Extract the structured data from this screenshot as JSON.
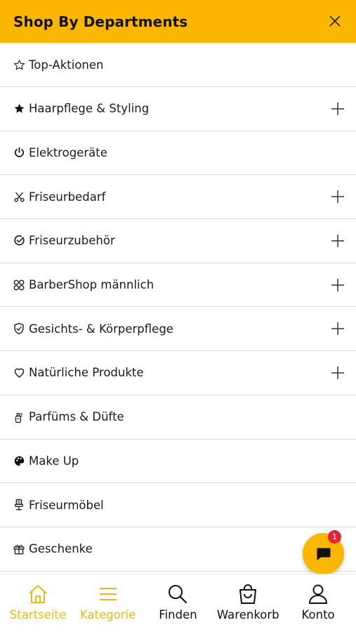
{
  "header": {
    "title": "Shop By Departments"
  },
  "menu": {
    "items": [
      {
        "label": "Top-Aktionen",
        "icon": "star-outline-icon",
        "expandable": false
      },
      {
        "label": "Haarpflege & Styling",
        "icon": "star-filled-icon",
        "expandable": true
      },
      {
        "label": "Elektrogeräte",
        "icon": "power-icon",
        "expandable": false
      },
      {
        "label": "Friseurbedarf",
        "icon": "scissors-icon",
        "expandable": true
      },
      {
        "label": "Friseurzubehör",
        "icon": "check-circle-icon",
        "expandable": true
      },
      {
        "label": "BarberShop männlich",
        "icon": "flower-icon",
        "expandable": true
      },
      {
        "label": "Gesichts- & Körperpflege",
        "icon": "shield-check-icon",
        "expandable": true
      },
      {
        "label": "Natürliche Produkte",
        "icon": "heart-icon",
        "expandable": true
      },
      {
        "label": "Parfüms & Düfte",
        "icon": "spray-bottle-icon",
        "expandable": false
      },
      {
        "label": "Make Up",
        "icon": "palette-icon",
        "expandable": false
      },
      {
        "label": "Friseurmöbel",
        "icon": "barber-chair-icon",
        "expandable": false
      },
      {
        "label": "Geschenke",
        "icon": "gift-icon",
        "expandable": false
      }
    ]
  },
  "chat": {
    "badge_count": "1"
  },
  "bottom_nav": {
    "items": [
      {
        "label": "Startseite",
        "icon": "home-icon"
      },
      {
        "label": "Kategorie",
        "icon": "menu-icon"
      },
      {
        "label": "Finden",
        "icon": "search-icon"
      },
      {
        "label": "Warenkorb",
        "icon": "bag-icon"
      },
      {
        "label": "Konto",
        "icon": "user-icon"
      }
    ]
  },
  "colors": {
    "accent": "#FBB600",
    "active_nav": "#F0B619",
    "badge": "#E5243B"
  }
}
